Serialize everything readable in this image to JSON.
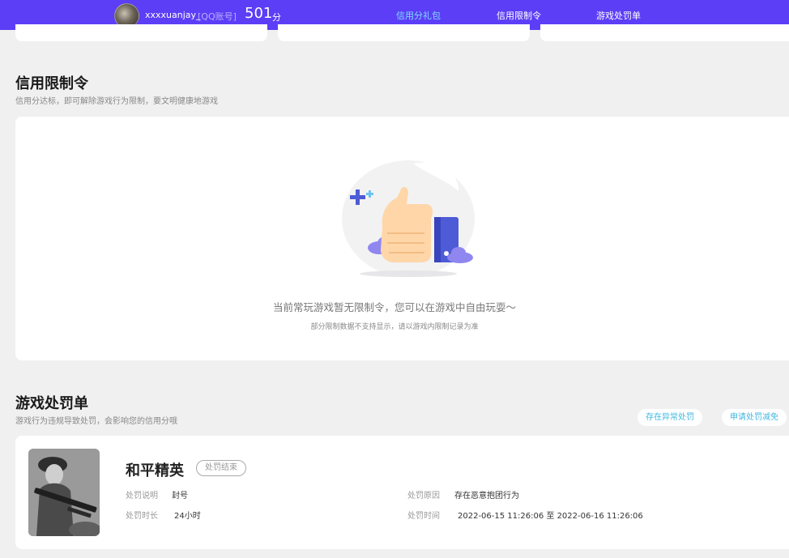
{
  "header": {
    "username": "xxxxuanjay_",
    "account_type": "[QQ账号]",
    "score": "501",
    "score_unit": "分",
    "tabs": [
      {
        "label": "信用分礼包",
        "active": true
      },
      {
        "label": "信用限制令",
        "active": false
      },
      {
        "label": "游戏处罚单",
        "active": false
      }
    ]
  },
  "restriction": {
    "title": "信用限制令",
    "subtitle": "信用分达标，即可解除游戏行为限制，要文明健康地游戏",
    "empty_message": "当前常玩游戏暂无限制令，您可以在游戏中自由玩耍～",
    "empty_note": "部分限制数据不支持显示，请以游戏内限制记录为准"
  },
  "penalty": {
    "title": "游戏处罚单",
    "subtitle": "游戏行为违规导致处罚，会影响您的信用分哦",
    "buttons": {
      "appeal": "存在异常处罚",
      "reduce": "申请处罚减免"
    },
    "records": [
      {
        "game": "和平精英",
        "status": "处罚结束",
        "desc_label": "处罚说明",
        "desc_value": "封号",
        "duration_label": "处罚时长",
        "duration_value": "24小时",
        "reason_label": "处罚原因",
        "reason_value": "存在恶意抱团行为",
        "time_label": "处罚时间",
        "time_value": "2022-06-15 11:26:06 至 2022-06-16 11:26:06"
      }
    ]
  },
  "colors": {
    "header_bg": "#5c3ef6",
    "active_tab": "#7fdcff",
    "link_blue": "#3fb8e0"
  }
}
